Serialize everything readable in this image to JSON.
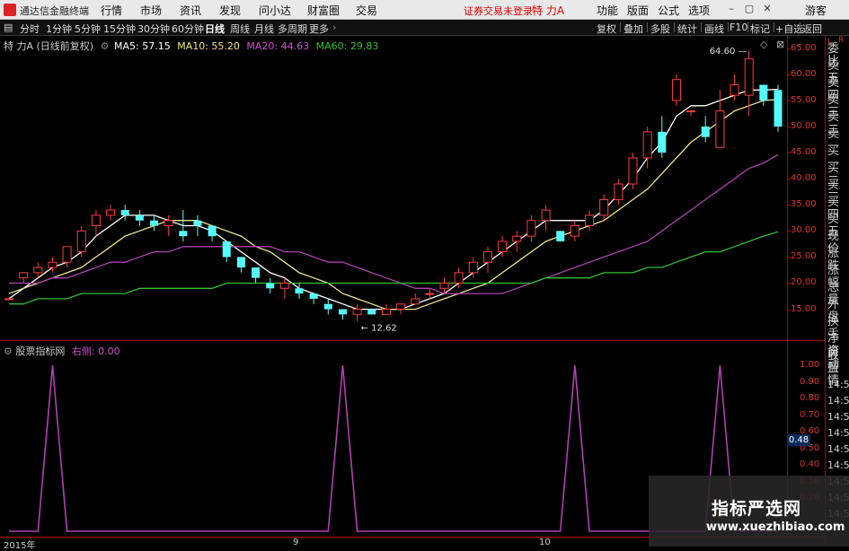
{
  "app": {
    "name": "通达信金融终端",
    "menus": [
      "行情",
      "市场",
      "资讯",
      "发现",
      "问小达",
      "财富圈",
      "交易"
    ],
    "login_status": "证券交易未登录",
    "stock_name": "特 力A",
    "right_menus": [
      "功能",
      "版面",
      "公式",
      "选项"
    ],
    "guest": "游客"
  },
  "toolbar": {
    "periods": [
      "分时",
      "1分钟",
      "5分钟",
      "15分钟",
      "30分钟",
      "60分钟",
      "日线",
      "周线",
      "月线",
      "多周期",
      "更多"
    ],
    "active_period": "日线",
    "buttons": [
      "复权",
      "叠加",
      "多股",
      "统计",
      "画线",
      "F10",
      "标记",
      "+自选",
      "返回"
    ]
  },
  "main_chart": {
    "title": "特 力A (日线前复权)",
    "ma_labels": [
      {
        "label": "MA5: 57.15",
        "color": "#ffffff"
      },
      {
        "label": "MA10: 55.20",
        "color": "#f0e68c"
      },
      {
        "label": "MA20: 44.63",
        "color": "#d050d0"
      },
      {
        "label": "MA60: 29.83",
        "color": "#30c030"
      }
    ],
    "yticks": [
      "65.00",
      "60.00",
      "55.00",
      "50.00",
      "45.00",
      "40.00",
      "35.00",
      "30.00",
      "25.00",
      "20.00",
      "15.00"
    ],
    "high_label": "64.60",
    "low_label": "12.62"
  },
  "indicator": {
    "title": "股票指标网",
    "param": "右侧: 0.00",
    "yticks": [
      "1.00",
      "0.90",
      "0.80",
      "0.70",
      "0.60",
      "0.50",
      "0.40",
      "0.30",
      "0.20"
    ],
    "value_box": "0.48"
  },
  "bottom_axis": [
    "2015年",
    "9",
    "10"
  ],
  "right_panel": {
    "top": [
      "L",
      "R"
    ],
    "items": [
      "委比",
      "卖五",
      "卖四",
      "卖三",
      "卖二",
      "卖一",
      "买一",
      "买二",
      "买三",
      "买四",
      "买五",
      "现价",
      "涨跌",
      "涨幅",
      "总量",
      "外盘",
      "换手",
      "净资",
      "收益"
    ],
    "lower": [
      "自动",
      "行情",
      "14:5",
      "14:5",
      "14:5",
      "14:5",
      "14:5",
      "14:5",
      "14:5",
      "14:5",
      "14:5"
    ]
  },
  "watermark": {
    "line1": "指标严选网",
    "line2": "www.xuezhibiao.com"
  },
  "chart_data": [
    {
      "type": "candlestick",
      "title": "特 力A (日线前复权)",
      "ylim": [
        12,
        66
      ],
      "candles": [
        [
          17,
          17,
          17,
          17
        ],
        [
          21,
          22,
          20,
          22
        ],
        [
          22,
          24,
          21,
          23
        ],
        [
          23,
          25,
          22,
          24
        ],
        [
          24,
          27,
          23,
          27
        ],
        [
          26,
          31,
          25,
          30
        ],
        [
          31,
          34,
          29,
          33
        ],
        [
          33,
          35,
          32,
          34
        ],
        [
          34,
          35,
          32,
          33
        ],
        [
          33,
          34,
          31,
          32
        ],
        [
          32,
          33,
          30,
          31
        ],
        [
          31,
          33,
          29,
          32
        ],
        [
          30,
          34,
          28,
          29
        ],
        [
          32,
          33,
          29,
          31
        ],
        [
          31,
          31,
          28,
          29
        ],
        [
          28,
          28,
          24,
          25
        ],
        [
          25,
          25,
          22,
          23
        ],
        [
          23,
          23,
          20,
          21
        ],
        [
          20,
          21,
          18,
          19
        ],
        [
          19,
          21,
          17,
          20
        ],
        [
          19,
          20,
          17,
          18
        ],
        [
          18,
          18,
          16,
          17
        ],
        [
          16,
          17,
          14,
          15
        ],
        [
          15,
          15,
          13,
          14
        ],
        [
          14,
          16,
          12.62,
          15
        ],
        [
          15,
          15,
          14,
          14
        ],
        [
          14,
          16,
          14,
          15
        ],
        [
          15,
          16,
          14,
          16
        ],
        [
          16,
          18,
          16,
          17
        ],
        [
          18,
          19,
          17,
          18
        ],
        [
          19,
          21,
          18,
          20
        ],
        [
          20,
          23,
          19,
          22
        ],
        [
          22,
          25,
          21,
          24
        ],
        [
          24,
          27,
          22,
          26
        ],
        [
          26,
          29,
          25,
          28
        ],
        [
          28,
          30,
          26,
          29
        ],
        [
          29,
          33,
          28,
          32
        ],
        [
          32,
          35,
          30,
          34
        ],
        [
          30,
          30,
          28,
          28
        ],
        [
          29,
          32,
          28,
          31
        ],
        [
          31,
          34,
          30,
          33
        ],
        [
          33,
          37,
          32,
          36
        ],
        [
          36,
          40,
          35,
          39
        ],
        [
          39,
          45,
          38,
          44
        ],
        [
          44,
          50,
          42,
          49
        ],
        [
          49,
          52,
          44,
          45
        ],
        [
          55,
          60,
          54,
          59
        ],
        [
          53,
          53,
          52,
          53
        ],
        [
          50,
          52,
          47,
          48
        ],
        [
          46,
          57,
          46,
          53
        ],
        [
          56,
          60,
          55,
          58
        ],
        [
          56,
          64.6,
          52,
          63
        ],
        [
          58,
          58,
          54,
          55
        ],
        [
          57,
          58,
          49,
          50
        ]
      ],
      "ma": [
        {
          "name": "MA5",
          "color": "#ffffff",
          "values": [
            17,
            19,
            21,
            23,
            24,
            26,
            29,
            31,
            33,
            33,
            33,
            32,
            31,
            31,
            30,
            28,
            26,
            24,
            22,
            21,
            19,
            18,
            17,
            16,
            15,
            15,
            15,
            15,
            16,
            17,
            18,
            20,
            22,
            24,
            26,
            28,
            30,
            32,
            32,
            32,
            32,
            34,
            37,
            40,
            44,
            47,
            52,
            54,
            54,
            55,
            56,
            57,
            57,
            57.15
          ]
        },
        {
          "name": "MA10",
          "color": "#f0e68c",
          "values": [
            18,
            19,
            20,
            21,
            22,
            23,
            25,
            27,
            29,
            30,
            31,
            32,
            32,
            32,
            31,
            30,
            29,
            27,
            26,
            24,
            22,
            21,
            20,
            18,
            17,
            16,
            15,
            15,
            15,
            16,
            17,
            18,
            19,
            20,
            22,
            24,
            26,
            28,
            29,
            30,
            31,
            32,
            34,
            36,
            38,
            41,
            44,
            47,
            49,
            51,
            53,
            54,
            55,
            55.2
          ]
        },
        {
          "name": "MA20",
          "color": "#b040b0",
          "values": [
            20,
            20,
            20,
            21,
            21,
            22,
            23,
            24,
            24,
            25,
            26,
            26,
            27,
            27,
            27,
            27,
            27,
            27,
            27,
            26,
            26,
            25,
            24,
            24,
            23,
            22,
            21,
            20,
            19,
            19,
            18,
            18,
            18,
            18,
            18,
            19,
            20,
            21,
            22,
            23,
            24,
            25,
            26,
            27,
            28,
            30,
            32,
            34,
            36,
            38,
            40,
            42,
            43,
            44.63
          ]
        },
        {
          "name": "MA60",
          "color": "#30c030",
          "values": [
            16,
            16,
            17,
            17,
            17,
            18,
            18,
            18,
            18,
            19,
            19,
            19,
            19,
            19,
            19,
            20,
            20,
            20,
            20,
            20,
            20,
            20,
            20,
            20,
            20,
            20,
            20,
            20,
            20,
            20,
            20,
            20,
            20,
            20,
            20,
            20,
            20,
            21,
            21,
            21,
            21,
            22,
            22,
            22,
            23,
            23,
            24,
            25,
            26,
            26,
            27,
            28,
            29,
            29.83
          ]
        }
      ]
    },
    {
      "type": "line",
      "title": "股票指标网",
      "ylim": [
        0,
        1.05
      ],
      "series": [
        {
          "name": "右侧",
          "color": "#b040b0",
          "values": [
            0,
            0,
            0,
            1,
            0,
            0,
            0,
            0,
            0,
            0,
            0,
            0,
            0,
            0,
            0,
            0,
            0,
            0,
            0,
            0,
            0,
            0,
            0,
            1,
            0,
            0,
            0,
            0,
            0,
            0,
            0,
            0,
            0,
            0,
            0,
            0,
            0,
            0,
            0,
            1,
            0,
            0,
            0,
            0,
            0,
            0,
            0,
            0,
            0,
            1,
            0,
            0,
            0,
            0
          ]
        }
      ]
    }
  ]
}
